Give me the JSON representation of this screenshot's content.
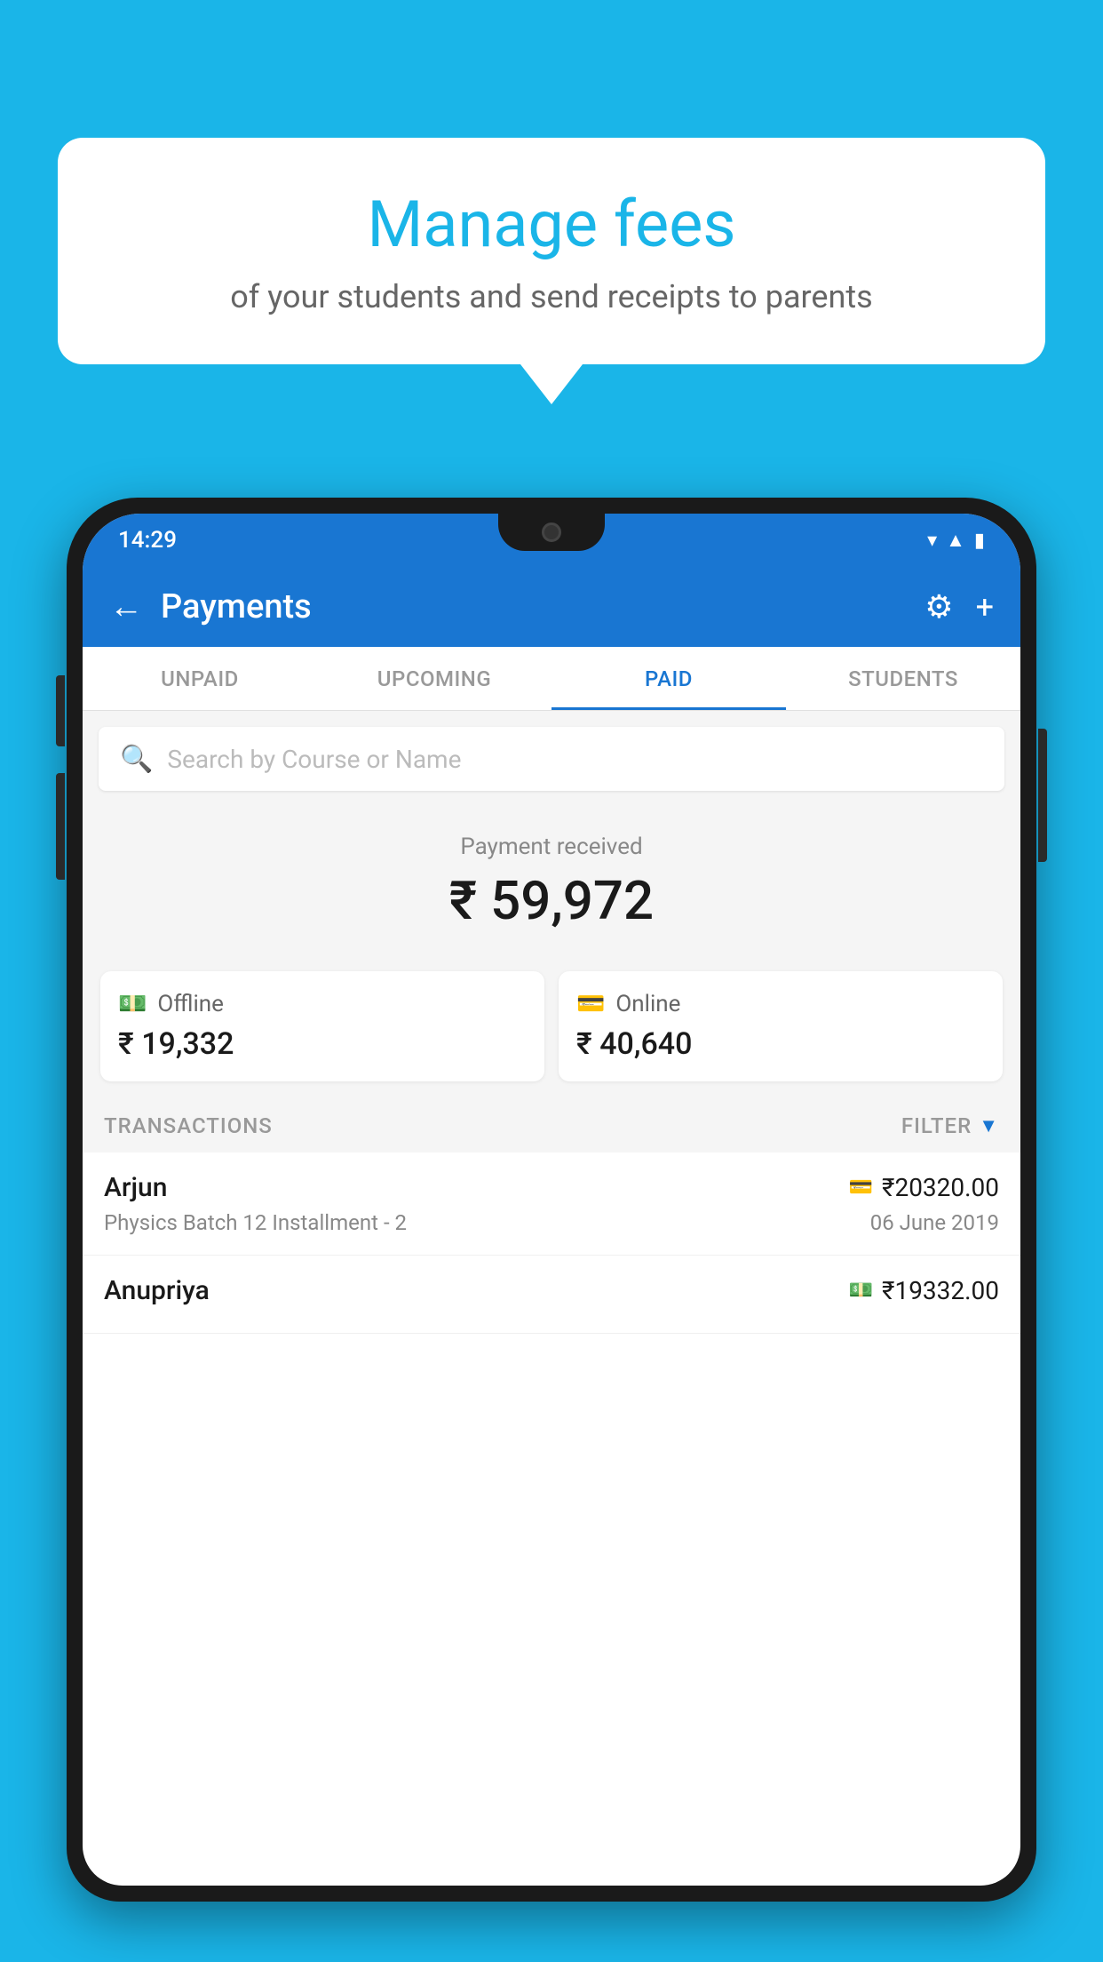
{
  "background_color": "#1ab5e8",
  "speech_bubble": {
    "title": "Manage fees",
    "subtitle": "of your students and send receipts to parents"
  },
  "status_bar": {
    "time": "14:29",
    "icons": [
      "wifi",
      "signal",
      "battery"
    ]
  },
  "top_nav": {
    "back_label": "←",
    "title": "Payments",
    "settings_icon": "⚙",
    "add_icon": "+"
  },
  "tabs": [
    {
      "label": "UNPAID",
      "active": false
    },
    {
      "label": "UPCOMING",
      "active": false
    },
    {
      "label": "PAID",
      "active": true
    },
    {
      "label": "STUDENTS",
      "active": false
    }
  ],
  "search": {
    "placeholder": "Search by Course or Name"
  },
  "payment_section": {
    "label": "Payment received",
    "amount": "₹ 59,972",
    "offline": {
      "type": "Offline",
      "amount": "₹ 19,332"
    },
    "online": {
      "type": "Online",
      "amount": "₹ 40,640"
    }
  },
  "transactions": {
    "label": "TRANSACTIONS",
    "filter_label": "FILTER",
    "items": [
      {
        "name": "Arjun",
        "course": "Physics Batch 12 Installment - 2",
        "amount": "₹20320.00",
        "date": "06 June 2019",
        "payment_type": "card"
      },
      {
        "name": "Anupriya",
        "course": "",
        "amount": "₹19332.00",
        "date": "",
        "payment_type": "cash"
      }
    ]
  }
}
